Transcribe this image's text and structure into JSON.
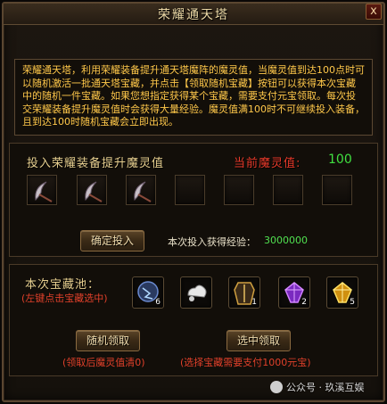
{
  "window": {
    "title": "荣耀通天塔",
    "close_label": "x"
  },
  "description": "荣耀通天塔，利用荣耀装备提升通天塔魔阵的魔灵值，当魔灵值到达100点时可以随机激活一批通天塔宝藏，并点击【领取随机宝藏】按钮可以获得本次宝藏中的随机一件宝藏。如果您想指定获得某个宝藏，需要支付元宝领取。每次投交荣耀装备提升魔灵值时会获得大量经验。魔灵值满100时不可继续投入装备，且到达100时随机宝藏会立即出现。",
  "invest": {
    "label": "投入荣耀装备提升魔灵值",
    "current_label": "当前魔灵值:",
    "current_value": "100",
    "slots": [
      {
        "icon": "scythe-icon",
        "filled": true
      },
      {
        "icon": "scythe-icon",
        "filled": true
      },
      {
        "icon": "scythe-icon",
        "filled": true
      },
      {
        "icon": "empty-slot",
        "filled": false
      },
      {
        "icon": "empty-slot",
        "filled": false
      },
      {
        "icon": "empty-slot",
        "filled": false
      },
      {
        "icon": "empty-slot",
        "filled": false
      }
    ],
    "confirm_label": "确定投入",
    "exp_label": "本次投入获得经验：",
    "exp_value": "3000000"
  },
  "treasure": {
    "label": "本次宝藏池：",
    "hint": "(左键点击宝藏选中)",
    "items": [
      {
        "icon": "blue-orb-icon",
        "count": "6"
      },
      {
        "icon": "white-cloud-icon",
        "count": ""
      },
      {
        "icon": "armor-icon",
        "count": "1"
      },
      {
        "icon": "purple-gem-icon",
        "count": "2"
      },
      {
        "icon": "gold-gem-icon",
        "count": "5"
      }
    ],
    "random_label": "随机领取",
    "random_note": "(领取后魔灵值清0)",
    "select_label": "选中领取",
    "select_note": "(选择宝藏需要支付1000元宝)"
  },
  "watermark": {
    "text": "公众号 · 玖溪互娱"
  },
  "colors": {
    "desc_text": "#ffc84a",
    "red_label": "#e83a2a",
    "green_value": "#40e040"
  }
}
